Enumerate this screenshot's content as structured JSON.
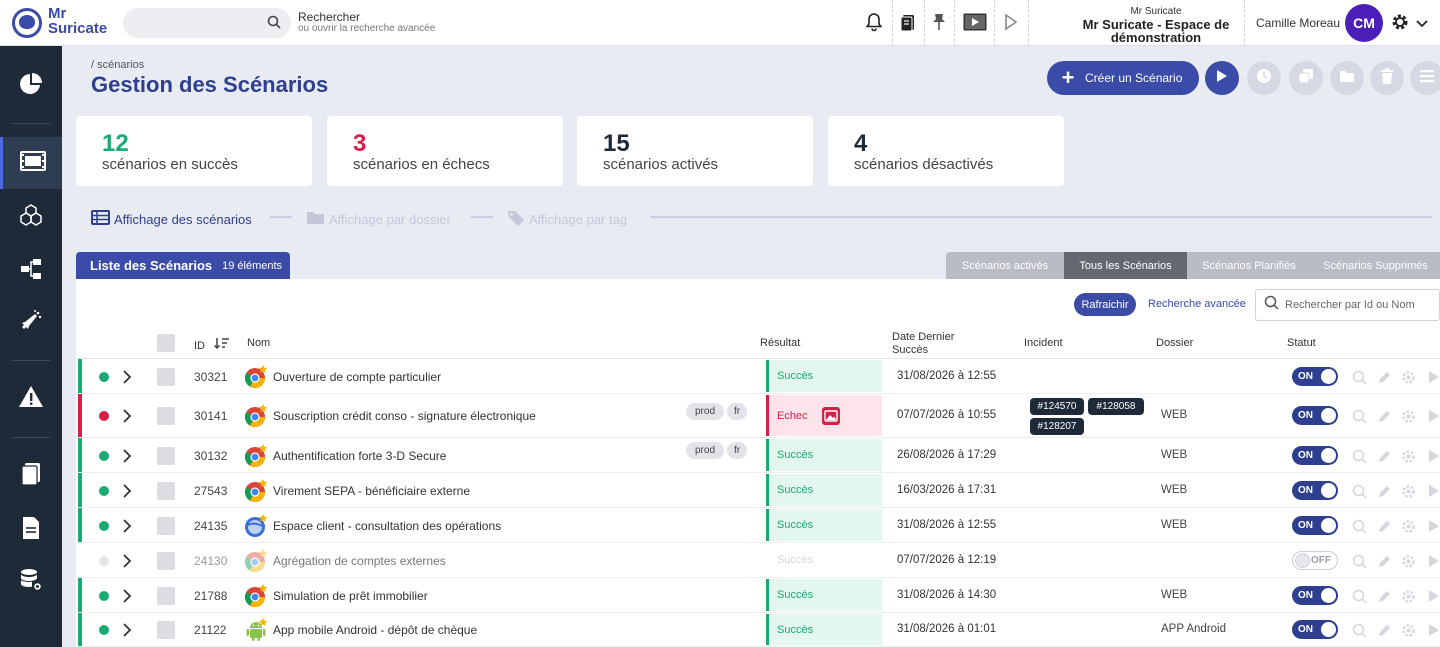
{
  "app": {
    "logo_line1": "Mr",
    "logo_line2": "Suricate"
  },
  "search": {
    "label": "Rechercher",
    "hint": "ou ouvrir la recherche avancée"
  },
  "workspace": {
    "sub": "Mr Suricate",
    "line1": "Mr Suricate - Espace de",
    "line2": "démonstration"
  },
  "user": {
    "name": "Camille Moreau",
    "initials": "CM"
  },
  "page": {
    "breadcrumb": "/ scénarios",
    "title": "Gestion des Scénarios",
    "create_label": "Créer un Scénario"
  },
  "stats": [
    {
      "value": "12",
      "label": "scénarios en succès",
      "color": "#1aaa72"
    },
    {
      "value": "3",
      "label": "scénarios en échecs",
      "color": "#d6204a"
    },
    {
      "value": "15",
      "label": "scénarios activés",
      "color": "#1f2a38"
    },
    {
      "value": "4",
      "label": "scénarios désactivés",
      "color": "#1f2a38"
    }
  ],
  "views": [
    {
      "label": "Affichage des scénarios",
      "active": true
    },
    {
      "label": "Affichage par dossier",
      "active": false
    },
    {
      "label": "Affichage par tag",
      "active": false
    }
  ],
  "list": {
    "title": "Liste des Scénarios",
    "count": "19 éléments"
  },
  "filters": [
    "Scénarios activés",
    "Tous les Scénarios",
    "Scénarios Planifiés",
    "Scénarios Supprimés"
  ],
  "toolbar": {
    "refresh": "Rafraichir",
    "advanced": "Recherche avancée",
    "search_placeholder": "Rechercher par Id ou Nom"
  },
  "columns": {
    "id": "ID",
    "name": "Nom",
    "result": "Résultat",
    "date_l1": "Date Dernier",
    "date_l2": "Succès",
    "incident": "Incident",
    "dossier": "Dossier",
    "status": "Statut"
  },
  "colors": {
    "primary": "#3a4ba8",
    "success": "#1aaa72",
    "failure": "#d6204a",
    "dark": "#1f2a38"
  },
  "rows": [
    {
      "id": "30321",
      "name": "Ouverture de compte particulier",
      "tags": [],
      "result": "Succès",
      "status": "success",
      "date": "31/08/2026 à 12:55",
      "incidents": [],
      "dossier": "",
      "toggle": "ON",
      "icon": "chrome-icon"
    },
    {
      "id": "30141",
      "name": "Souscription crédit conso - signature électronique",
      "tags": [
        "prod",
        "fr"
      ],
      "result": "Echec",
      "status": "failure",
      "date": "07/07/2026 à 10:55",
      "incidents": [
        "#124570",
        "#128058",
        "#128207"
      ],
      "dossier": "WEB",
      "toggle": "ON",
      "icon": "chrome-icon"
    },
    {
      "id": "30132",
      "name": "Authentification forte 3-D Secure",
      "tags": [
        "prod",
        "fr"
      ],
      "result": "Succès",
      "status": "success",
      "date": "26/08/2026 à 17:29",
      "incidents": [],
      "dossier": "WEB",
      "toggle": "ON",
      "icon": "chrome-icon"
    },
    {
      "id": "27543",
      "name": "Virement SEPA - bénéficiaire externe",
      "tags": [],
      "result": "Succès",
      "status": "success",
      "date": "16/03/2026 à 17:31",
      "incidents": [],
      "dossier": "WEB",
      "toggle": "ON",
      "icon": "chrome-icon"
    },
    {
      "id": "24135",
      "name": "Espace client - consultation des opérations",
      "tags": [],
      "result": "Succès",
      "status": "success",
      "date": "31/08/2026 à 12:55",
      "incidents": [],
      "dossier": "WEB",
      "toggle": "ON",
      "icon": "browser-icon"
    },
    {
      "id": "24130",
      "name": "Agrégation de comptes externes",
      "tags": [],
      "result": "Succès",
      "status": "disabled",
      "date": "07/07/2026 à 12:19",
      "incidents": [],
      "dossier": "",
      "toggle": "OFF",
      "icon": "chrome-icon"
    },
    {
      "id": "21788",
      "name": "Simulation de prêt immobilier",
      "tags": [],
      "result": "Succès",
      "status": "success",
      "date": "31/08/2026 à 14:30",
      "incidents": [],
      "dossier": "WEB",
      "toggle": "ON",
      "icon": "chrome-icon"
    },
    {
      "id": "21122",
      "name": "App mobile Android - dépôt de chèque",
      "tags": [],
      "result": "Succès",
      "status": "success",
      "date": "31/08/2026 à 01:01",
      "incidents": [],
      "dossier": "APP Android",
      "toggle": "ON",
      "icon": "android-icon"
    }
  ]
}
